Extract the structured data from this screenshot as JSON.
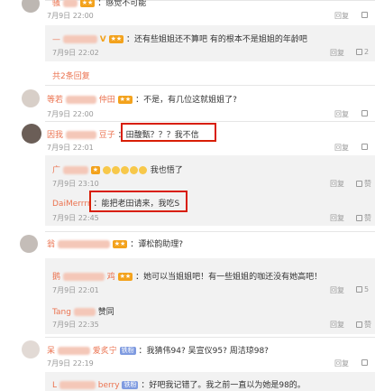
{
  "comments": [
    {
      "name": "骚",
      "text": "：感觉不可能",
      "time": "7月9日 22:00"
    },
    {
      "name": "—",
      "text": "：还有些姐姐还不算吧 有的根本不是姐姐的年龄吧",
      "time": "7月9日 22:02",
      "nested": true
    },
    {
      "more": "共2条回复"
    },
    {
      "name": "等若",
      "name2": "仲田",
      "text": "：不是，有几位这就姐姐了?",
      "time": "7月9日 22:00"
    },
    {
      "name": "因我",
      "name2": "豆子",
      "text": "：田馥甄？？？我不信",
      "time": "7月9日 22:01"
    },
    {
      "name": "广",
      "text": "我也悟了",
      "time": "7月9日 23:10",
      "nested": true
    },
    {
      "name": "DaiMerrrr",
      "text": "：能把老田请来，我吃S",
      "time": "7月9日 22:45",
      "nested": true
    },
    {
      "name": "翁",
      "text": "：谭松韵助理?",
      "time": "7月9日 22:00"
    },
    {
      "name": "鹅",
      "name2": "鸡",
      "text": "：她可以当姐姐吧！有一些姐姐的咖还没有她高吧！",
      "time": "7月9日 22:01",
      "nested": true
    },
    {
      "name": "Tang",
      "text": "赞同",
      "time": "7月9日 22:35",
      "nested": true
    },
    {
      "name": "呆",
      "name2": "爱炙宁",
      "text": "：我猜伟94? 吴宣仪95? 周洁琼98?",
      "time": "7月9日 22:19"
    },
    {
      "name": "L",
      "name2": "berry",
      "text": "：好吧我记错了。我之前一直以为她是98的。",
      "time": ""
    }
  ],
  "actions": {
    "reply": "回复",
    "like_5": "5"
  }
}
